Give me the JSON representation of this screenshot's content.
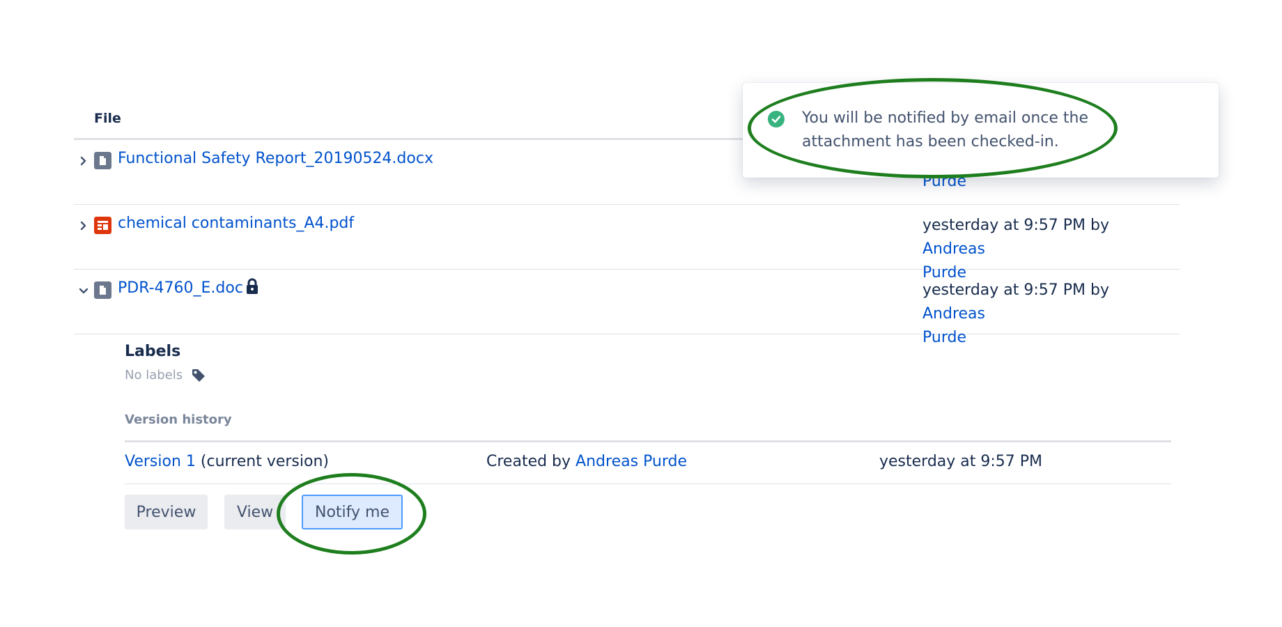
{
  "table": {
    "header_file": "File"
  },
  "rows": [
    {
      "filename": "Functional Safety Report_20190524.docx",
      "modified_name": "Purde"
    },
    {
      "filename": "chemical contaminants_A4.pdf",
      "modified_time": "yesterday at 9:57 PM by ",
      "modified_name_first": "Andreas",
      "modified_name_last": "Purde"
    },
    {
      "filename": "PDR-4760_E.doc",
      "modified_time": "yesterday at 9:57 PM by ",
      "modified_name_first": "Andreas",
      "modified_name_last": "Purde"
    }
  ],
  "details": {
    "labels_title": "Labels",
    "labels_empty": "No labels",
    "version_history_title": "Version history",
    "version": {
      "version_link": "Version 1",
      "version_suffix": " (current version)",
      "created_by_prefix": "Created by ",
      "created_by_name": "Andreas Purde",
      "date": "yesterday at 9:57 PM"
    },
    "buttons": {
      "preview": "Preview",
      "view": "View",
      "notify": "Notify me"
    }
  },
  "flag": {
    "message_line1": "You will be notified by email once the",
    "message_line2": "attachment has been checked-in."
  },
  "colors": {
    "link": "#0052CC",
    "success": "#36B37E",
    "pdf_icon": "#DE350B",
    "doc_icon": "#6B778C",
    "annotation": "#1E7E1E"
  }
}
